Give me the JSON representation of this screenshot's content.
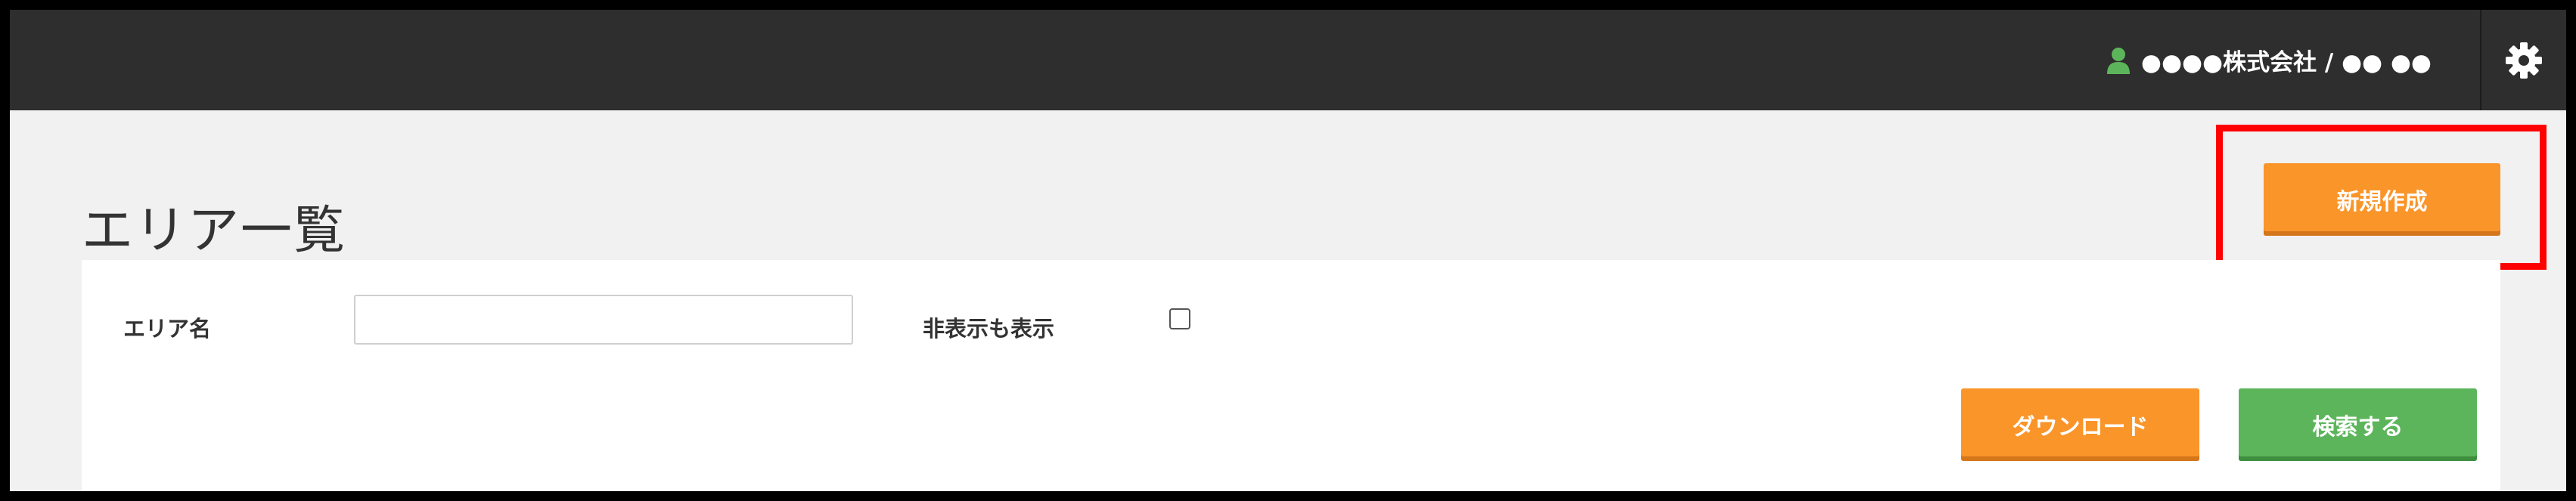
{
  "header": {
    "user_label": "●●●●株式会社 / ●● ●●",
    "user_icon": "user-icon",
    "settings_icon": "gear-icon",
    "accent_user_icon_color": "#5db55b"
  },
  "page": {
    "title": "エリア一覧"
  },
  "toolbar": {
    "new_label": "新規作成"
  },
  "filters": {
    "area_name_label": "エリア名",
    "area_name_value": "",
    "show_hidden_label": "非表示も表示",
    "show_hidden_checked": false
  },
  "actions": {
    "download_label": "ダウンロード",
    "search_label": "検索する"
  },
  "colors": {
    "orange": "#fa952a",
    "green": "#5db55b",
    "topbar": "#2e2e2e",
    "highlight": "#ff0000"
  }
}
